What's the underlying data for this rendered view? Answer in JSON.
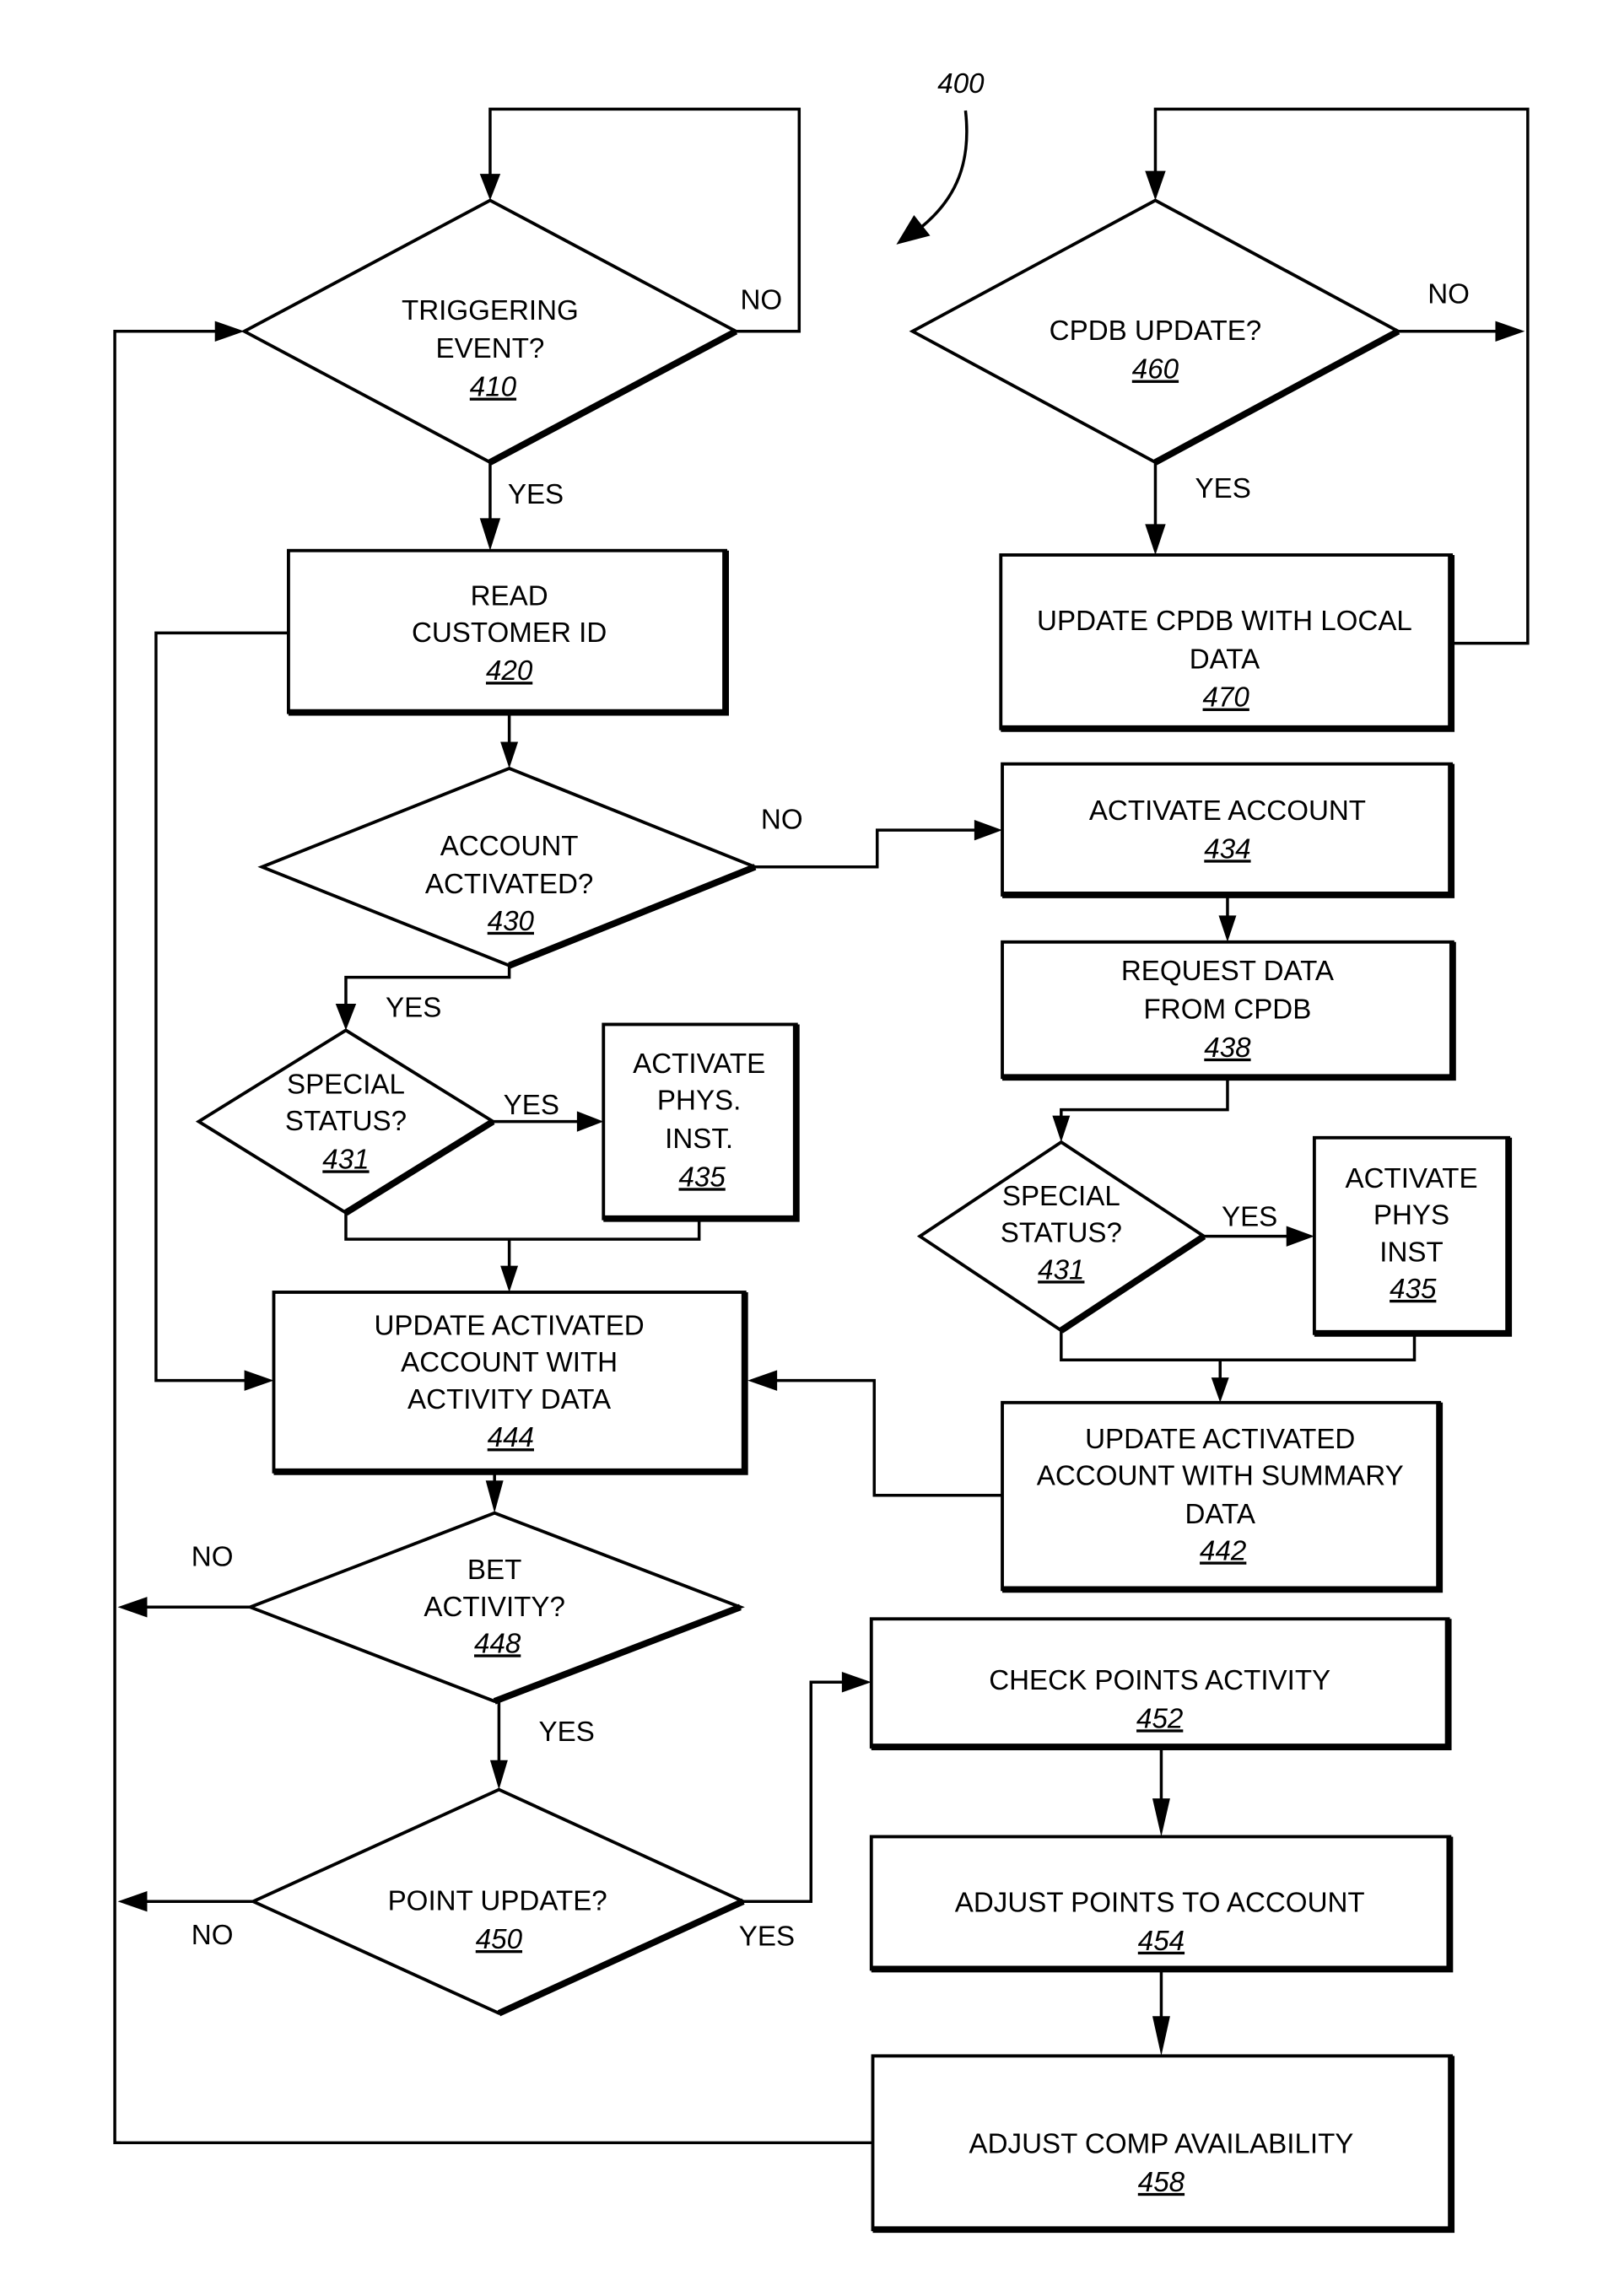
{
  "figure": {
    "number": "400",
    "colors": {
      "line": "#000000",
      "background": "#ffffff"
    }
  },
  "nodes": {
    "n410": {
      "type": "decision",
      "lines": [
        "TRIGGERING",
        "EVENT?"
      ],
      "ref": "410"
    },
    "n420": {
      "type": "process",
      "lines": [
        "READ",
        "CUSTOMER ID"
      ],
      "ref": "420"
    },
    "n430": {
      "type": "decision",
      "lines": [
        "ACCOUNT",
        "ACTIVATED?"
      ],
      "ref": "430"
    },
    "n431a": {
      "type": "decision",
      "lines": [
        "SPECIAL",
        "STATUS?"
      ],
      "ref": "431"
    },
    "n435a": {
      "type": "process",
      "lines": [
        "ACTIVATE",
        "PHYS.",
        "INST."
      ],
      "ref": "435"
    },
    "n444": {
      "type": "process",
      "lines": [
        "UPDATE ACTIVATED",
        "ACCOUNT WITH",
        "ACTIVITY DATA"
      ],
      "ref": "444"
    },
    "n448": {
      "type": "decision",
      "lines": [
        "BET",
        "ACTIVITY?"
      ],
      "ref": "448"
    },
    "n450": {
      "type": "decision",
      "lines": [
        "POINT UPDATE?"
      ],
      "ref": "450"
    },
    "n460": {
      "type": "decision",
      "lines": [
        "CPDB UPDATE?"
      ],
      "ref": "460"
    },
    "n470": {
      "type": "process",
      "lines": [
        "UPDATE CPDB WITH LOCAL",
        "DATA"
      ],
      "ref": "470"
    },
    "n434": {
      "type": "process",
      "lines": [
        "ACTIVATE ACCOUNT"
      ],
      "ref": "434"
    },
    "n438": {
      "type": "process",
      "lines": [
        "REQUEST DATA",
        "FROM CPDB"
      ],
      "ref": "438"
    },
    "n431b": {
      "type": "decision",
      "lines": [
        "SPECIAL",
        "STATUS?"
      ],
      "ref": "431"
    },
    "n435b": {
      "type": "process",
      "lines": [
        "ACTIVATE",
        "PHYS",
        "INST"
      ],
      "ref": "435"
    },
    "n442": {
      "type": "process",
      "lines": [
        "UPDATE ACTIVATED",
        "ACCOUNT WITH SUMMARY",
        "DATA"
      ],
      "ref": "442"
    },
    "n452": {
      "type": "process",
      "lines": [
        "CHECK POINTS ACTIVITY"
      ],
      "ref": "452"
    },
    "n454": {
      "type": "process",
      "lines": [
        "ADJUST POINTS TO ACCOUNT"
      ],
      "ref": "454"
    },
    "n458": {
      "type": "process",
      "lines": [
        "ADJUST COMP AVAILABILITY"
      ],
      "ref": "458"
    }
  },
  "edge_labels": {
    "e410_no": "NO",
    "e410_yes": "YES",
    "e460_no": "NO",
    "e460_yes": "YES",
    "e430_no": "NO",
    "e430_yes": "YES",
    "e431a_yes": "YES",
    "e431b_yes": "YES",
    "e448_no": "NO",
    "e448_yes": "YES",
    "e450_no": "NO",
    "e450_yes": "YES"
  },
  "edges": [
    {
      "from": "410",
      "to": "420",
      "label": "YES"
    },
    {
      "from": "410",
      "to": "410",
      "label": "NO"
    },
    {
      "from": "420",
      "to": "430"
    },
    {
      "from": "420",
      "to": "444"
    },
    {
      "from": "430",
      "to": "431",
      "label": "YES"
    },
    {
      "from": "430",
      "to": "434",
      "label": "NO"
    },
    {
      "from": "431",
      "to": "435",
      "label": "YES"
    },
    {
      "from": "431",
      "to": "444"
    },
    {
      "from": "435",
      "to": "444"
    },
    {
      "from": "434",
      "to": "438"
    },
    {
      "from": "438",
      "to": "431"
    },
    {
      "from": "431",
      "to": "442"
    },
    {
      "from": "435",
      "to": "442"
    },
    {
      "from": "442",
      "to": "444"
    },
    {
      "from": "444",
      "to": "448"
    },
    {
      "from": "448",
      "to": "450",
      "label": "YES"
    },
    {
      "from": "448",
      "to": "410",
      "label": "NO"
    },
    {
      "from": "450",
      "to": "452",
      "label": "YES"
    },
    {
      "from": "450",
      "to": "410",
      "label": "NO"
    },
    {
      "from": "452",
      "to": "454"
    },
    {
      "from": "454",
      "to": "458"
    },
    {
      "from": "458",
      "to": "410"
    },
    {
      "from": "460",
      "to": "470",
      "label": "YES"
    },
    {
      "from": "460",
      "to": "460",
      "label": "NO"
    },
    {
      "from": "470",
      "to": "460"
    }
  ]
}
